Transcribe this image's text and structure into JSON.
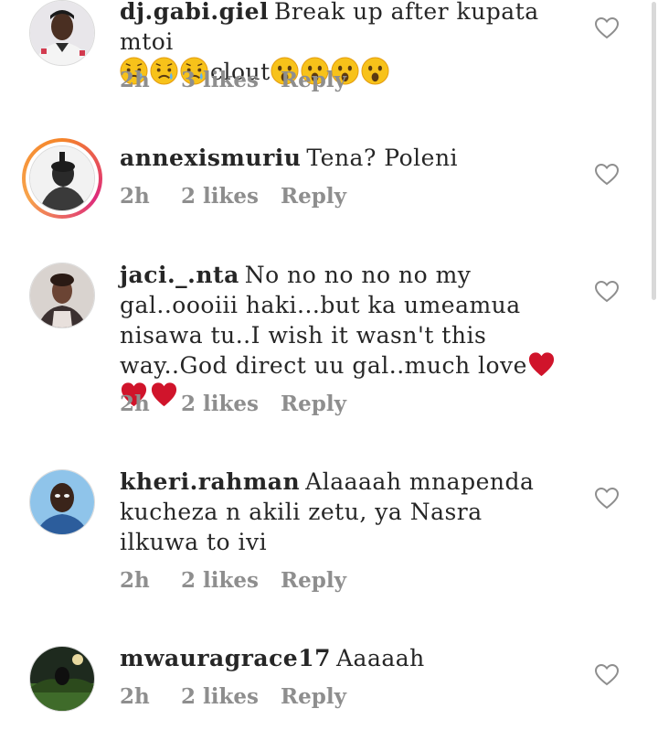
{
  "comments": [
    {
      "username": "dj.gabi.giel",
      "text": "Break up after kupata mtoi",
      "text_suffix": "clout",
      "emoji_before": [
        "disappointed-relieved",
        "disappointed-relieved",
        "disappointed-relieved"
      ],
      "emoji_after": [
        "astonished",
        "astonished",
        "astonished",
        "astonished"
      ],
      "time": "2h",
      "likes": "3 likes",
      "reply": "Reply",
      "story_ring": false
    },
    {
      "username": "annexismuriu",
      "text": "Tena? Poleni",
      "time": "2h",
      "likes": "2 likes",
      "reply": "Reply",
      "story_ring": true
    },
    {
      "username": "jaci._.nta",
      "text": "No no no no no my gal..oooiii haki...but ka umeamua nisawa tu..I wish it wasn't this way..God direct uu gal..much love",
      "emoji_after": [
        "red-heart",
        "red-heart",
        "red-heart"
      ],
      "time": "2h",
      "likes": "2 likes",
      "reply": "Reply",
      "story_ring": false
    },
    {
      "username": "kheri.rahman",
      "text": "Alaaaah mnapenda kucheza n akili zetu, ya Nasra ilkuwa to ivi",
      "time": "2h",
      "likes": "2 likes",
      "reply": "Reply",
      "story_ring": false
    },
    {
      "username": "mwauragrace17",
      "text": "Aaaaah",
      "time": "2h",
      "likes": "2 likes",
      "reply": "Reply",
      "story_ring": false
    }
  ],
  "icons": {
    "like": "heart-outline-icon"
  },
  "colors": {
    "text": "#262626",
    "meta": "#8e8e8e",
    "heart_red": "#d0142b"
  }
}
